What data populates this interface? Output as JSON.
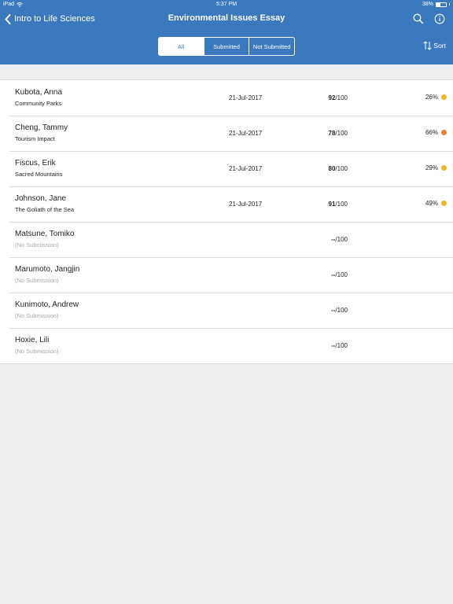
{
  "status_bar": {
    "device": "iPad",
    "time": "5:37 PM",
    "battery": "38%",
    "battery_level": 0.38
  },
  "nav": {
    "back_label": "Intro to Life Sciences",
    "title": "Environmental Issues Essay",
    "search_icon": "search-icon",
    "info_icon": "info-icon"
  },
  "filter": {
    "segments": [
      {
        "label": "All",
        "active": true
      },
      {
        "label": "Submitted",
        "active": false
      },
      {
        "label": "Not Submitted",
        "active": false
      }
    ],
    "sort_label": "Sort"
  },
  "colors": {
    "header": "#3a79bd",
    "dot_yellow": "#f2b52c",
    "dot_orange": "#ef7f33"
  },
  "students": [
    {
      "name": "Kubota, Anna",
      "title": "Community Parks",
      "date": "21-Jul-2017",
      "score": "92",
      "max": "/100",
      "pct": "26%",
      "dot": "#f2b52c"
    },
    {
      "name": "Cheng, Tammy",
      "title": "Tourism Impact",
      "date": "21-Jul-2017",
      "score": "78",
      "max": "/100",
      "pct": "66%",
      "dot": "#ef7f33"
    },
    {
      "name": "Fiscus, Erik",
      "title": "Sacred Mountains",
      "date": "21-Jul-2017",
      "score": "80",
      "max": "/100",
      "pct": "29%",
      "dot": "#f2b52c"
    },
    {
      "name": "Johnson, Jane",
      "title": "The Goliath of the Sea",
      "date": "21-Jul-2017",
      "score": "91",
      "max": "/100",
      "pct": "49%",
      "dot": "#f2b52c"
    },
    {
      "name": "Matsune, Tomiko",
      "title": "(No Submission)",
      "date": "",
      "score": "--",
      "max": "/100",
      "pct": "",
      "dot": ""
    },
    {
      "name": "Marumoto, Jangjin",
      "title": "(No Submission)",
      "date": "",
      "score": "--",
      "max": "/100",
      "pct": "",
      "dot": ""
    },
    {
      "name": "Kunimoto, Andrew",
      "title": "(No Submission)",
      "date": "",
      "score": "--",
      "max": "/100",
      "pct": "",
      "dot": ""
    },
    {
      "name": "Hoxie, Lili",
      "title": "(No Submission)",
      "date": "",
      "score": "--",
      "max": "/100",
      "pct": "",
      "dot": ""
    }
  ]
}
